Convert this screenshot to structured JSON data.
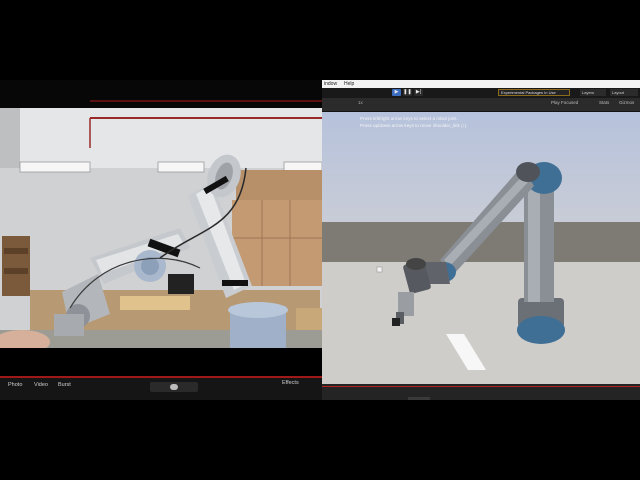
{
  "camera": {
    "modes": {
      "photo": "Photo",
      "video": "Video",
      "burst": "Burst"
    },
    "effects_label": "Effects",
    "accent_color": "#a01818"
  },
  "unity": {
    "menu": {
      "window": "indow",
      "help": "Help"
    },
    "toolbar": {
      "play_icon": "play-icon",
      "pause_icon": "pause-icon",
      "step_icon": "step-icon",
      "package_label": "Experimental Packages In Use",
      "layers_label": "Layers",
      "layout_label": "Layout"
    },
    "gamebar": {
      "scale_label": "1x",
      "play_focused": "Play Focused",
      "stats": "Stats",
      "gizmos": "Gizmos"
    },
    "hints": [
      "Press left/right arrow keys to select a robot joint.",
      "Press up/down arrow keys to move shoulder_link (↕)."
    ],
    "accent_color": "#3a6cc0"
  }
}
